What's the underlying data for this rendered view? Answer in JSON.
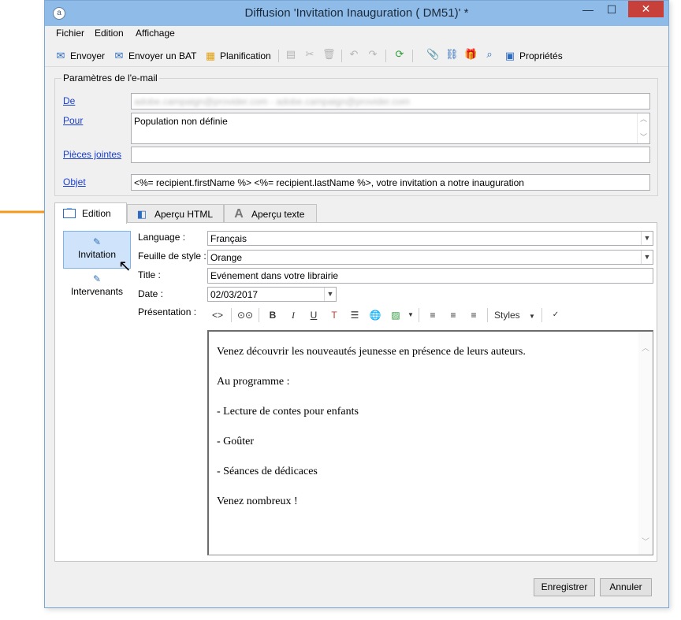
{
  "window": {
    "title": "Diffusion 'Invitation Inauguration ( DM51)' *",
    "app_icon": "adobe-campaign-icon",
    "controls": {
      "minimize": "—",
      "maximize": "☐",
      "close": "✕"
    }
  },
  "menu": [
    "Fichier",
    "Edition",
    "Affichage"
  ],
  "toolbar": {
    "send": "Envoyer",
    "send_proof": "Envoyer un BAT",
    "planning": "Planification",
    "properties": "Propriétés"
  },
  "email_params": {
    "legend": "Paramètres de l'e-mail",
    "from_label": "De",
    "from_value": "adobe.campaign@provider.com - adobe.campaign@provider.com",
    "to_label": "Pour",
    "to_value": "Population non définie",
    "attachments_label": "Pièces jointes",
    "attachments_value": "",
    "subject_label": "Objet",
    "subject_value": "<%= recipient.firstName %> <%= recipient.lastName %>, votre invitation a notre inauguration"
  },
  "tabs": [
    {
      "label": "Edition",
      "icon": "edit-window-icon",
      "active": true
    },
    {
      "label": "Aperçu HTML",
      "icon": "html-preview-icon",
      "active": false
    },
    {
      "label": "Aperçu texte",
      "icon": "text-preview-icon",
      "active": false
    }
  ],
  "sidebar": [
    {
      "label": "Invitation",
      "icon": "form-edit-icon",
      "active": true
    },
    {
      "label": "Intervenants",
      "icon": "form-edit-icon",
      "active": false
    }
  ],
  "form": {
    "language_label": "Language :",
    "language_value": "Français",
    "stylesheet_label": "Feuille de style :",
    "stylesheet_value": "Orange",
    "title_label": "Title :",
    "title_value": "Evénement dans votre librairie",
    "date_label": "Date :",
    "date_value": "02/03/2017",
    "presentation_label": "Présentation :"
  },
  "editor_toolbar": {
    "styles_label": "Styles"
  },
  "editor_content": [
    "Venez découvrir les nouveautés jeunesse en présence de leurs auteurs.",
    "Au programme :",
    "- Lecture de contes pour enfants",
    "- Goûter",
    "- Séances de dédicaces",
    "Venez nombreux !"
  ],
  "buttons": {
    "save": "Enregistrer",
    "cancel": "Annuler"
  },
  "colors": {
    "titlebar": "#8fbbe8",
    "accent_arrow": "#f39a1e",
    "link": "#1a3fd0",
    "close": "#c7403a"
  }
}
